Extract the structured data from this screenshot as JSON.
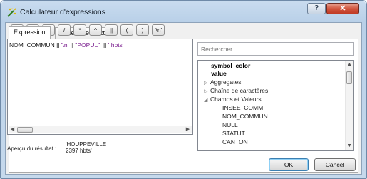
{
  "window": {
    "title": "Calculateur d'expressions",
    "help_label": "?",
    "close_label": "✕"
  },
  "tabs": [
    {
      "label": "Expression",
      "active": true
    },
    {
      "label": "Éditeur de fonction",
      "active": false
    }
  ],
  "operators": [
    "=",
    "+",
    "-",
    "/",
    "*",
    "^",
    "||",
    "(",
    ")",
    "'\\n'"
  ],
  "editor": {
    "expression_parts": [
      {
        "text": "NOM_COMMUN || ",
        "kind": "field"
      },
      {
        "text": "'\\n'",
        "kind": "string"
      },
      {
        "text": " || ",
        "kind": "field"
      },
      {
        "text": "\"POPUL\"",
        "kind": "string"
      },
      {
        "text": "  || ",
        "kind": "field"
      },
      {
        "text": "' hbts'",
        "kind": "string"
      }
    ]
  },
  "preview": {
    "label": "Aperçu du résultat :",
    "value": "'HOUPPEVILLE\n2397 hbts'"
  },
  "search": {
    "placeholder": "Rechercher"
  },
  "tree": [
    {
      "label": "symbol_color",
      "bold": true,
      "arrow": ""
    },
    {
      "label": "value",
      "bold": true,
      "arrow": ""
    },
    {
      "label": "Aggregates",
      "bold": false,
      "arrow": "▷"
    },
    {
      "label": "Chaîne de caractères",
      "bold": false,
      "arrow": "▷"
    },
    {
      "label": "Champs et Valeurs",
      "bold": false,
      "arrow": "◢"
    },
    {
      "label": "INSEE_COMM",
      "bold": false,
      "arrow": "",
      "child": true
    },
    {
      "label": "NOM_COMMUN",
      "bold": false,
      "arrow": "",
      "child": true
    },
    {
      "label": "NULL",
      "bold": false,
      "arrow": "",
      "child": true
    },
    {
      "label": "STATUT",
      "bold": false,
      "arrow": "",
      "child": true
    },
    {
      "label": "CANTON",
      "bold": false,
      "arrow": "",
      "child": true
    }
  ],
  "buttons": {
    "ok": "OK",
    "cancel": "Cancel"
  },
  "colors": {
    "accent_title": "#b9d0e8",
    "string_literal": "#7b1f8f",
    "close_red": "#c03a24"
  }
}
